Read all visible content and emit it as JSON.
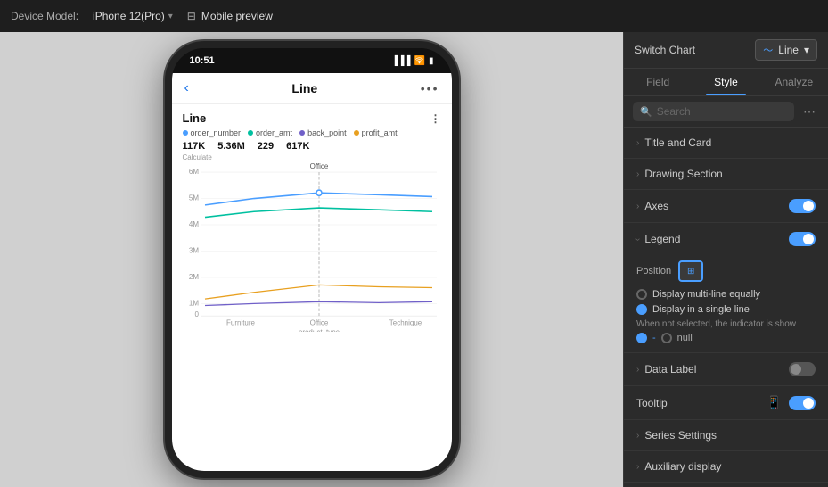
{
  "topbar": {
    "device_label": "Device Model:",
    "device_name": "iPhone 12(Pro)",
    "mobile_preview": "Mobile preview"
  },
  "phone": {
    "time": "10:51",
    "app_title": "Line",
    "chart_title": "Line",
    "metrics": [
      "117K",
      "5.36M",
      "229",
      "617K"
    ],
    "metric_labels": [
      "order_number",
      "order_amt",
      "back_point",
      "profit_amt"
    ],
    "y_label": "Calculate",
    "y_values": [
      "6M",
      "5M",
      "4M",
      "3M",
      "2M",
      "1M",
      "0"
    ],
    "x_labels": [
      "Furniture",
      "Office",
      "Technique"
    ],
    "x_main_label": "product_type",
    "office_label": "Office",
    "legend_colors": [
      "#4a9eff",
      "#00c0a0",
      "#7060c8",
      "#e8a020"
    ]
  },
  "right_panel": {
    "switch_chart_label": "Switch Chart",
    "chart_type": "Line",
    "tabs": [
      "Field",
      "Style",
      "Analyze"
    ],
    "active_tab": "Style",
    "search_placeholder": "Search",
    "search_more": "⋯",
    "options": {
      "title_and_card": "Title and Card",
      "drawing_section": "Drawing Section",
      "axes": "Axes",
      "legend": "Legend",
      "position_label": "Position",
      "radio1": "Display multi-line equally",
      "radio2": "Display in a single line",
      "hint": "When not selected, the indicator is show",
      "null_label": "null",
      "data_label": "Data Label",
      "tooltip": "Tooltip",
      "series_settings": "Series Settings",
      "auxiliary_display": "Auxiliary display"
    }
  }
}
